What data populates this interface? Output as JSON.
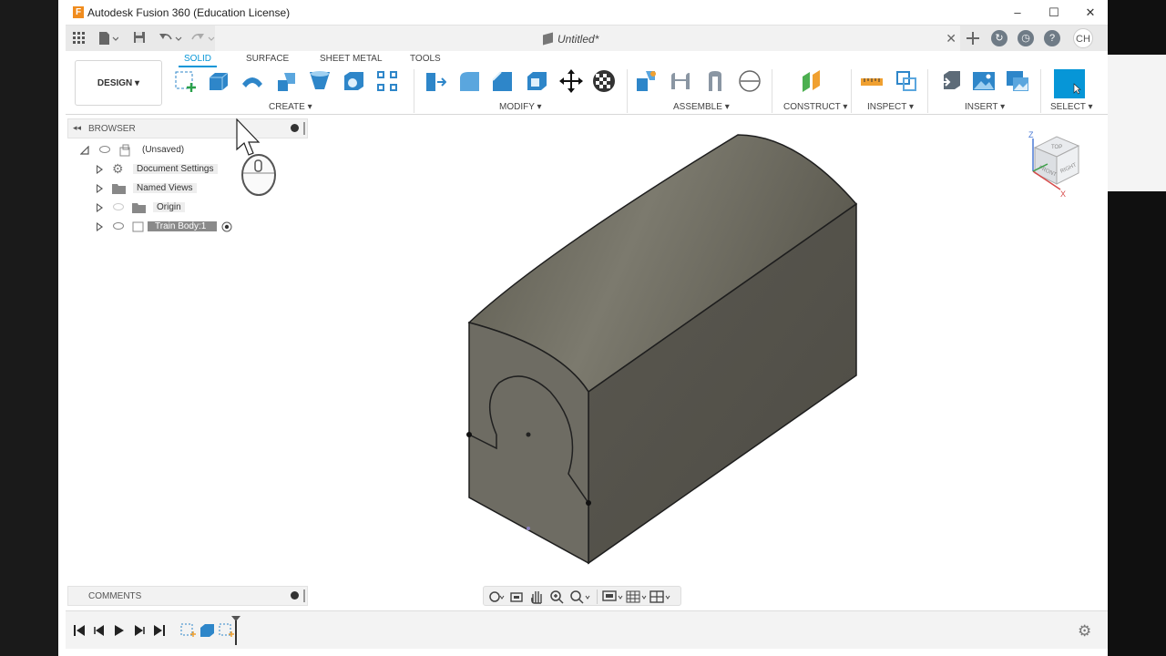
{
  "window": {
    "title": "Autodesk Fusion 360 (Education License)",
    "logo_letter": "F",
    "minimize": "–",
    "maximize": "☐",
    "close": "✕"
  },
  "document": {
    "title": "Untitled*",
    "close": "✕"
  },
  "user": {
    "initials": "CH"
  },
  "ribbon": {
    "workspace": "DESIGN ▾",
    "tabs": [
      "SOLID",
      "SURFACE",
      "SHEET METAL",
      "TOOLS"
    ],
    "groups": [
      "CREATE ▾",
      "MODIFY ▾",
      "ASSEMBLE ▾",
      "CONSTRUCT ▾",
      "INSPECT ▾",
      "INSERT ▾",
      "SELECT ▾"
    ]
  },
  "browser": {
    "title": "BROWSER",
    "items": [
      "(Unsaved)",
      "Document Settings",
      "Named Views",
      "Origin",
      "Train Body:1"
    ]
  },
  "comments": {
    "title": "COMMENTS"
  },
  "viewcube": {
    "top": "TOP",
    "front": "FRONT",
    "right": "RIGHT",
    "axis_z": "Z",
    "axis_x": "X"
  },
  "colors": {
    "accent": "#0696d7",
    "body": "#5e5b52",
    "ribbon_icon": "#2e86c9"
  }
}
